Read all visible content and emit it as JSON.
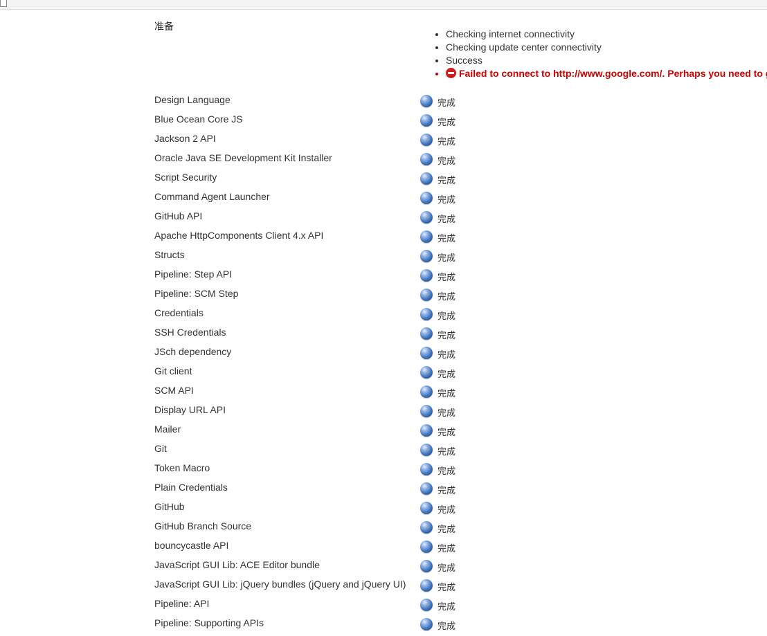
{
  "prep": {
    "label": "准备",
    "checks": [
      {
        "text": "Checking internet connectivity",
        "status": "info"
      },
      {
        "text": "Checking update center connectivity",
        "status": "info"
      },
      {
        "text": "Success",
        "status": "info"
      },
      {
        "text": "Failed to connect to http://www.google.com/. Perhaps you need to g",
        "status": "error",
        "icon": "error-no-entry-icon"
      }
    ]
  },
  "status_icon": "blue-ball-icon",
  "colors": {
    "error": "#cc0000",
    "status_ball": "#3e6fb8"
  },
  "plugins": [
    {
      "name": "Design Language",
      "status": "完成"
    },
    {
      "name": "Blue Ocean Core JS",
      "status": "完成"
    },
    {
      "name": "Jackson 2 API",
      "status": "完成"
    },
    {
      "name": "Oracle Java SE Development Kit Installer",
      "status": "完成"
    },
    {
      "name": "Script Security",
      "status": "完成"
    },
    {
      "name": "Command Agent Launcher",
      "status": "完成"
    },
    {
      "name": "GitHub API",
      "status": "完成"
    },
    {
      "name": "Apache HttpComponents Client 4.x API",
      "status": "完成"
    },
    {
      "name": "Structs",
      "status": "完成"
    },
    {
      "name": "Pipeline: Step API",
      "status": "完成"
    },
    {
      "name": "Pipeline: SCM Step",
      "status": "完成"
    },
    {
      "name": "Credentials",
      "status": "完成"
    },
    {
      "name": "SSH Credentials",
      "status": "完成"
    },
    {
      "name": "JSch dependency",
      "status": "完成"
    },
    {
      "name": "Git client",
      "status": "完成"
    },
    {
      "name": "SCM API",
      "status": "完成"
    },
    {
      "name": "Display URL API",
      "status": "完成"
    },
    {
      "name": "Mailer",
      "status": "完成"
    },
    {
      "name": "Git",
      "status": "完成"
    },
    {
      "name": "Token Macro",
      "status": "完成"
    },
    {
      "name": "Plain Credentials",
      "status": "完成"
    },
    {
      "name": "GitHub",
      "status": "完成"
    },
    {
      "name": "GitHub Branch Source",
      "status": "完成"
    },
    {
      "name": "bouncycastle API",
      "status": "完成"
    },
    {
      "name": "JavaScript GUI Lib: ACE Editor bundle",
      "status": "完成"
    },
    {
      "name": "JavaScript GUI Lib: jQuery bundles (jQuery and jQuery UI)",
      "status": "完成"
    },
    {
      "name": "Pipeline: API",
      "status": "完成"
    },
    {
      "name": "Pipeline: Supporting APIs",
      "status": "完成"
    }
  ]
}
